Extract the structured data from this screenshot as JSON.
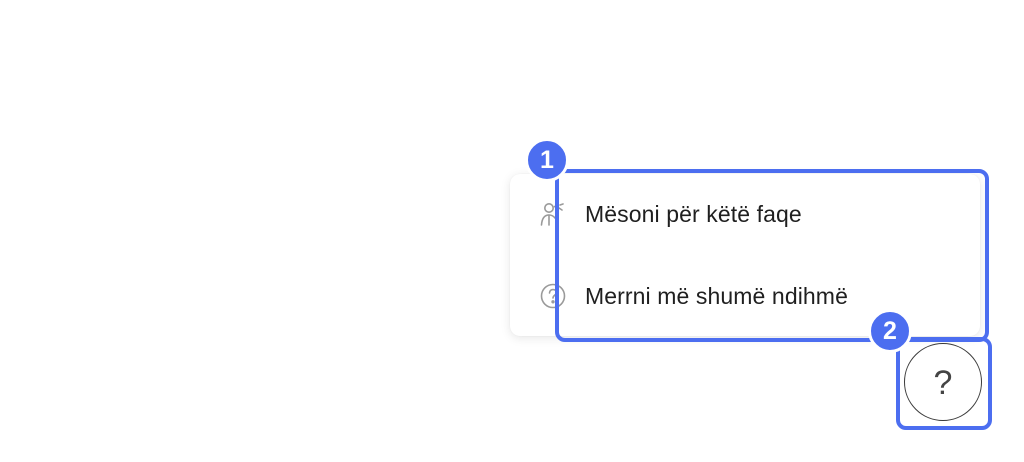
{
  "help_menu": {
    "items": [
      {
        "label": "Mësoni për këtë faqe",
        "icon": "guided-tour-icon"
      },
      {
        "label": "Merrni më shumë ndihmë",
        "icon": "help-circle-icon"
      }
    ]
  },
  "help_button": {
    "glyph": "?",
    "icon": "help-question-icon"
  },
  "annotations": {
    "badge_1": "1",
    "badge_2": "2"
  },
  "colors": {
    "annotation": "#4c6ef0",
    "menu_text": "#1f1f1f",
    "icon_gray": "#9a9a9a"
  }
}
